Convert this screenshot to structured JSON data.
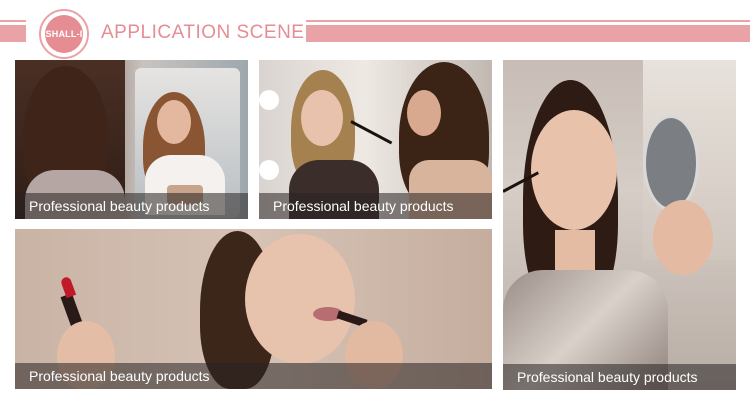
{
  "header": {
    "logo_text": "SHALL-I",
    "title": "APPLICATION SCENE"
  },
  "photos": [
    {
      "caption": "Professional beauty products",
      "scene": "makeup-mirror-scene"
    },
    {
      "caption": "Professional beauty products",
      "scene": "makeup-artist-scene"
    },
    {
      "caption": "Professional beauty products",
      "scene": "mascara-compact-mirror-scene"
    },
    {
      "caption": "Professional beauty products",
      "scene": "lipstick-application-scene"
    }
  ],
  "colors": {
    "accent": "#e9a2a6",
    "logo_fill": "#e68d94",
    "caption_bg": "#282222"
  }
}
